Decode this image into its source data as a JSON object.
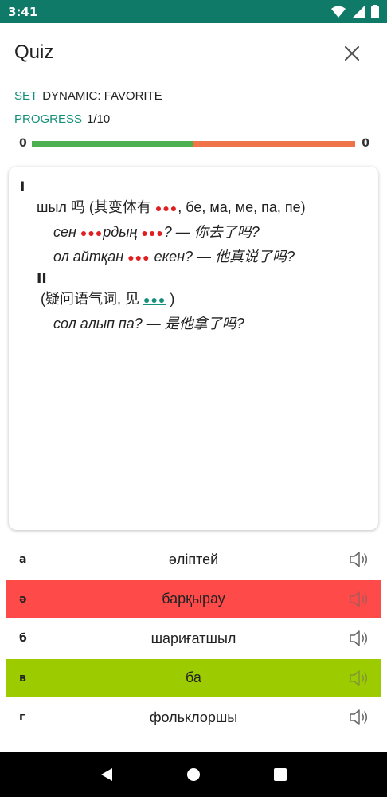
{
  "status": {
    "time": "3:41"
  },
  "header": {
    "title": "Quiz"
  },
  "meta": {
    "set_label": "SET",
    "set_value": "DYNAMIC: FAVORITE",
    "progress_label": "PROGRESS",
    "progress_value": "1/10"
  },
  "progress": {
    "left_count": "0",
    "right_count": "0",
    "fraction_green": 0.5
  },
  "card": {
    "section1": "I",
    "line1_a": "шыл 吗 (其变体有 ",
    "line1_dots": "●●●",
    "line1_b": ", бе, ма, ме, па, пе)",
    "line2_a": "сен ",
    "line2_dots1": "●●●",
    "line2_b": "рдың ",
    "line2_dots2": "●●●",
    "line2_c": "? — 你去了吗?",
    "line3_a": "ол айтқан ",
    "line3_dots": "●●●",
    "line3_b": " екен? — 他真说了吗?",
    "section2": "II",
    "line4_a": "(疑问语气词, 见 ",
    "line4_dots": "●●●",
    "line4_b": " )",
    "line5": "сол алып па? — 是他拿了吗?"
  },
  "options": [
    {
      "letter": "а",
      "text": "әліптей",
      "state": "normal"
    },
    {
      "letter": "ә",
      "text": "барқырау",
      "state": "wrong"
    },
    {
      "letter": "б",
      "text": "шариғатшыл",
      "state": "normal"
    },
    {
      "letter": "в",
      "text": "ба",
      "state": "correct"
    },
    {
      "letter": "г",
      "text": "фольклоршы",
      "state": "normal"
    }
  ],
  "colors": {
    "accent": "#14907a",
    "wrong": "#ff4a4a",
    "correct": "#9ccc00",
    "status_bar": "#0f7a68"
  }
}
